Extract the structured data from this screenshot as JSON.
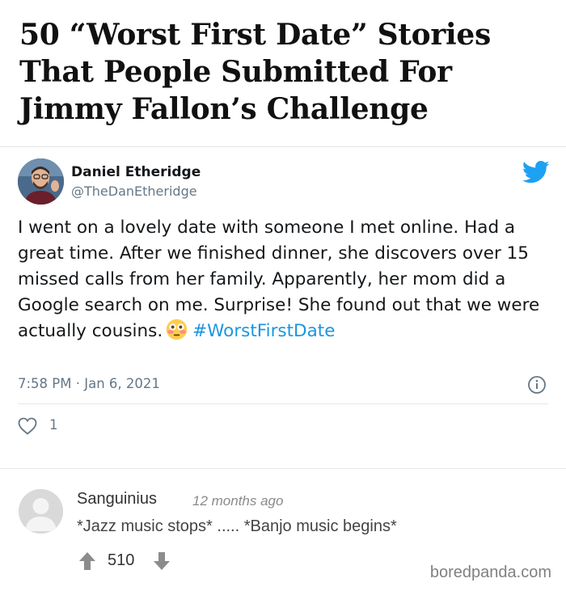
{
  "article": {
    "title": "50 “Worst First Date” Stories That People Submitted For Jimmy Fallon’s Challenge"
  },
  "tweet": {
    "author_name": "Daniel Etheridge",
    "author_handle": "@TheDanEtheridge",
    "text": "I went on a lovely date with someone I met online. Had a great time.  After we finished dinner, she discovers over 15 missed calls from her family. Apparently, her mom did a Google search on me. Surprise! She found out that we were actually cousins.",
    "emoji": "flushed-face",
    "hashtag": "#WorstFirstDate",
    "timestamp": "7:58 PM · Jan 6, 2021",
    "like_count": "1",
    "colors": {
      "link": "#1b95e0",
      "twitter_brand": "#1da1f2",
      "muted": "#657786"
    }
  },
  "comment": {
    "author": "Sanguinius",
    "time": "12 months ago",
    "text": "*Jazz music stops* ..... *Banjo music begins*",
    "votes": "510"
  },
  "watermark": "boredpanda.com"
}
